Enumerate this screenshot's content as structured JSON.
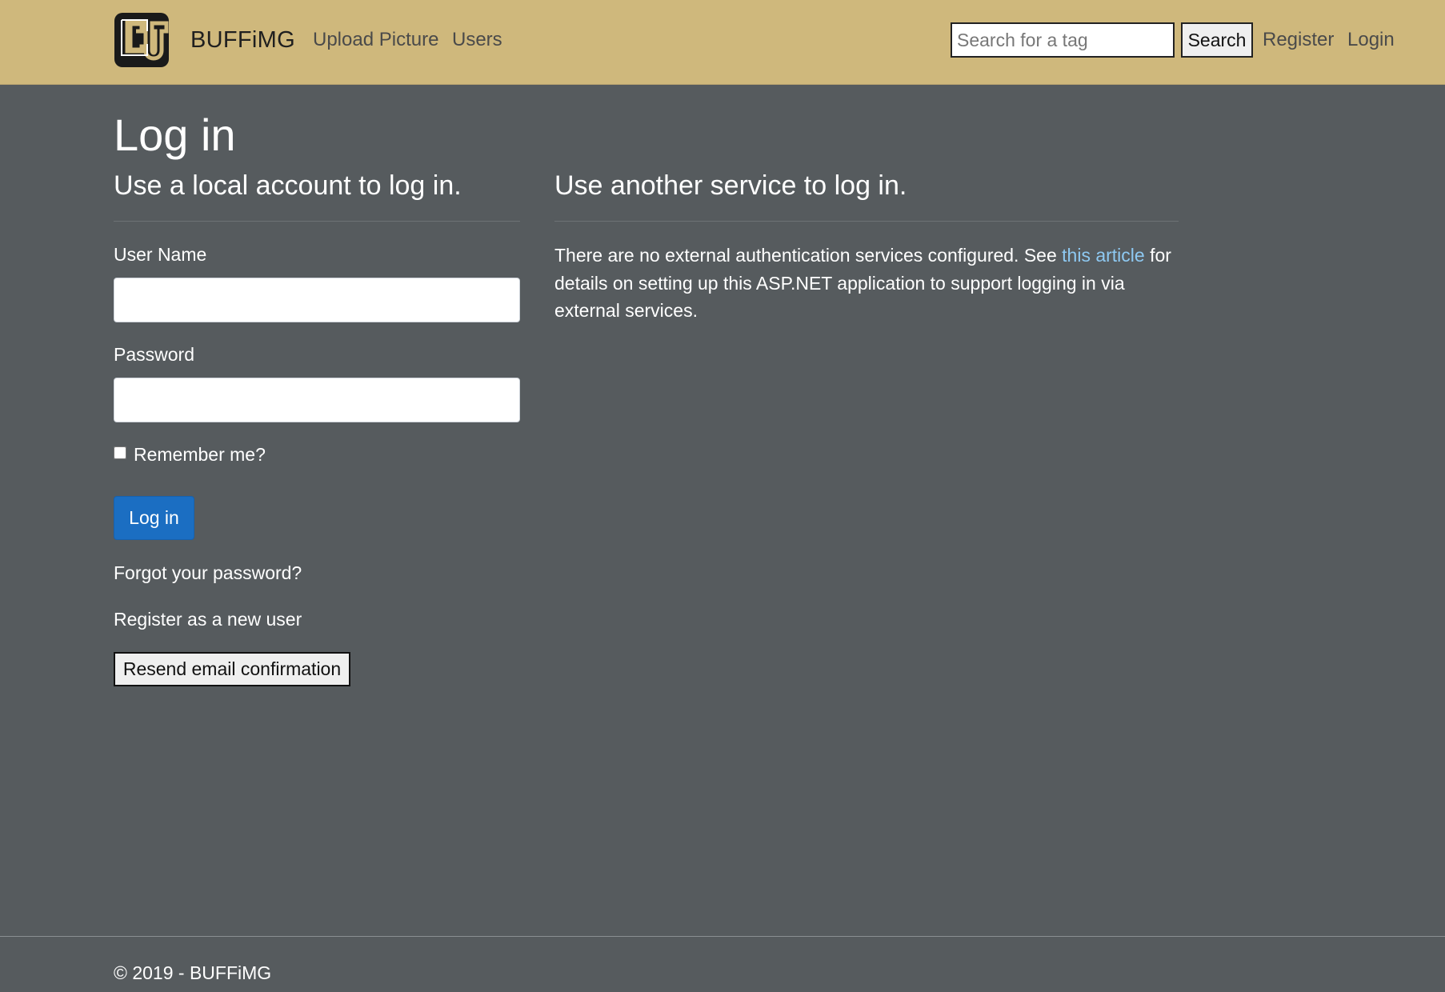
{
  "navbar": {
    "brand": "BUFFiMG",
    "logo_icon": "cu-logo-icon",
    "links": {
      "upload": "Upload Picture",
      "users": "Users",
      "register": "Register",
      "login": "Login"
    },
    "search": {
      "placeholder": "Search for a tag",
      "value": "",
      "button_label": "Search"
    },
    "background_color": "#cfb87c"
  },
  "main": {
    "title": "Log in",
    "local": {
      "heading": "Use a local account to log in.",
      "username_label": "User Name",
      "username_value": "",
      "password_label": "Password",
      "password_value": "",
      "remember_label": "Remember me?",
      "remember_checked": false,
      "login_button": "Log in",
      "forgot_link": "Forgot your password?",
      "register_link": "Register as a new user",
      "resend_button": "Resend email confirmation"
    },
    "external": {
      "heading": "Use another service to log in.",
      "text_before": "There are no external authentication services configured. See ",
      "link_text": "this article",
      "text_after": " for details on setting up this ASP.NET application to support logging in via external services."
    },
    "background_color": "#565b5e",
    "primary_button_color": "#1b6ec2",
    "link_color": "#8ec9f2"
  },
  "footer": {
    "text": "© 2019 - BUFFiMG"
  }
}
